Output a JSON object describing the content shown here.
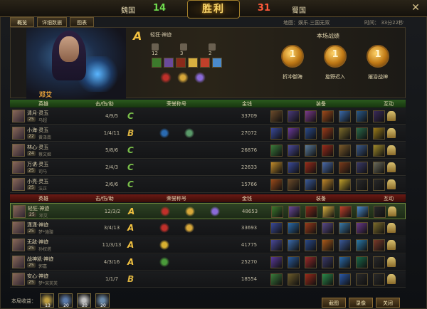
{
  "scoreboard": {
    "left_team": "魏国",
    "left_score": "14",
    "right_team": "蜀国",
    "right_score": "31",
    "logo_text": "胜利"
  },
  "tabs": [
    "概览",
    "详细数据",
    "图表"
  ],
  "info": {
    "map": "地图：娱乐.三国无双",
    "time": "时间： 33分22秒"
  },
  "hero": {
    "name": "邓艾",
    "grade": "A",
    "title": "轻狂·神迹",
    "stats": [
      "12",
      "3",
      "2"
    ],
    "item_colors": [
      "#3c7a2c",
      "#6a4a9a",
      "#8a2a1a",
      "#d8b040",
      "#c0402a",
      "#4a8acc"
    ],
    "badge_colors": [
      "#c0302a",
      "#d8a83a",
      "#8a6ad8"
    ]
  },
  "record": {
    "title": "本场战绩",
    "medals": [
      {
        "num": "1",
        "label": "折冲御海"
      },
      {
        "num": "1",
        "label": "旋野迟入"
      },
      {
        "num": "1",
        "label": "摧浴战神"
      }
    ]
  },
  "headers": {
    "hero": "英雄",
    "kda": "击/伤/助",
    "honor": "荣誉称号",
    "gold": "金钱",
    "equip": "装备",
    "interact": "互动"
  },
  "team_green": [
    {
      "name": "清月·灵玉",
      "level": "25",
      "sub": "马超",
      "kda": "4/9/5",
      "grade": "C",
      "gold": "33709",
      "honors": [],
      "items": [
        "#6a4a2a",
        "#4a3a7a",
        "#7a3a8a",
        "#a04a1a",
        "#3a6aaa",
        "#2a5a8a",
        "#3a2a5a"
      ]
    },
    {
      "name": "小海·灵玉",
      "level": "22",
      "sub": "黄泽南",
      "kda": "1/4/11",
      "grade": "B",
      "gold": "27072",
      "honors": [
        "#2a6ab0",
        "#5a9a6a"
      ],
      "items": [
        "#3a4a9a",
        "#6a3a9a",
        "#2a4a8a",
        "#9a3a1a",
        "#7a6a2a",
        "#2a6a4a",
        "#9a7a1a"
      ]
    },
    {
      "name": "林心·灵玉",
      "level": "24",
      "sub": "蔡文姬",
      "kda": "5/8/6",
      "grade": "C",
      "gold": "26876",
      "honors": [],
      "items": [
        "#3a7a3a",
        "#4a4a9a",
        "#5a7a9a",
        "#9a2a1a",
        "#7a5a2a",
        "#3a5a8a",
        "#a08a2a"
      ]
    },
    {
      "name": "万诱·灵玉",
      "level": "25",
      "sub": "司马",
      "kda": "2/4/3",
      "grade": "C",
      "gold": "22633",
      "honors": [],
      "items": [
        "#c08a2a",
        "#3a4a9a",
        "#9a2a1a",
        "#4a6aaa",
        "#7a3a1a",
        "#3a3a6a",
        "#6a6a5a"
      ]
    },
    {
      "name": "小亮·灵玉",
      "level": "25",
      "sub": "法正",
      "kda": "2/6/6",
      "grade": "C",
      "gold": "15766",
      "honors": [],
      "items": [
        "#9a4a1a",
        "#6a4a2a",
        "#3a5a9a",
        "#c0882a",
        "#c0a02a",
        "#2a2a2a",
        "#2a2a2a"
      ]
    }
  ],
  "team_red": [
    {
      "name": "轻狂·神迹",
      "level": "25",
      "sub": "邓艾",
      "kda": "12/3/2",
      "grade": "A",
      "gold": "48653",
      "highlight": true,
      "honors": [
        "#c0302a",
        "#d8a83a",
        "#8a6ad8"
      ],
      "items": [
        "#3c7a2c",
        "#6a4a9a",
        "#8a2a1a",
        "#d8b040",
        "#c0402a",
        "#4a8acc",
        "#2a2a2a"
      ]
    },
    {
      "name": "潇潇·神迹",
      "level": "25",
      "sub": "梦*施璇",
      "kda": "3/4/13",
      "grade": "A",
      "gold": "33693",
      "honors": [
        "#c0302a",
        "#d8a83a"
      ],
      "items": [
        "#3a4a9a",
        "#2a6aaa",
        "#9a3a1a",
        "#5a4a8a",
        "#3a7aaa",
        "#6a3a8a",
        "#7a6a2a"
      ]
    },
    {
      "name": "无敌·神迹",
      "level": "25",
      "sub": "孙权塔",
      "kda": "11/3/13",
      "grade": "A",
      "gold": "41775",
      "honors": [
        "#d8b030"
      ],
      "items": [
        "#4a4a9a",
        "#3a6aaa",
        "#2a4a8a",
        "#aa5a1a",
        "#3a5a9a",
        "#2a7aaa",
        "#7a3a2a"
      ]
    },
    {
      "name": "战神凯·神迹",
      "level": "25",
      "sub": "郭嘉",
      "kda": "4/3/16",
      "grade": "A",
      "gold": "25270",
      "honors": [
        "#4a9a3a"
      ],
      "items": [
        "#5a3a9a",
        "#2a5a9a",
        "#9a2a2a",
        "#3a3a6a",
        "#2a6aaa",
        "#1a6a4a",
        "#2a2a2a"
      ]
    },
    {
      "name": "安心·神迹",
      "level": "25",
      "sub": "梦*宋芙芙",
      "kda": "1/1/7",
      "grade": "B",
      "gold": "18554",
      "honors": [],
      "items": [
        "#3a7a3a",
        "#6a5a2a",
        "#9a2a1a",
        "#2a8a4a",
        "#2a5aaa",
        "#2a2a2a",
        "#2a2a2a"
      ]
    }
  ],
  "footer": {
    "label": "本局收益：",
    "chests": [
      {
        "v": "13",
        "c": "#c0a040"
      },
      {
        "v": "20",
        "c": "#5a7aaa"
      },
      {
        "v": "20",
        "c": "#c0c0c0"
      },
      {
        "v": "20",
        "c": "#6a8aaa"
      }
    ],
    "buttons": [
      "截图",
      "录像",
      "关闭"
    ]
  }
}
